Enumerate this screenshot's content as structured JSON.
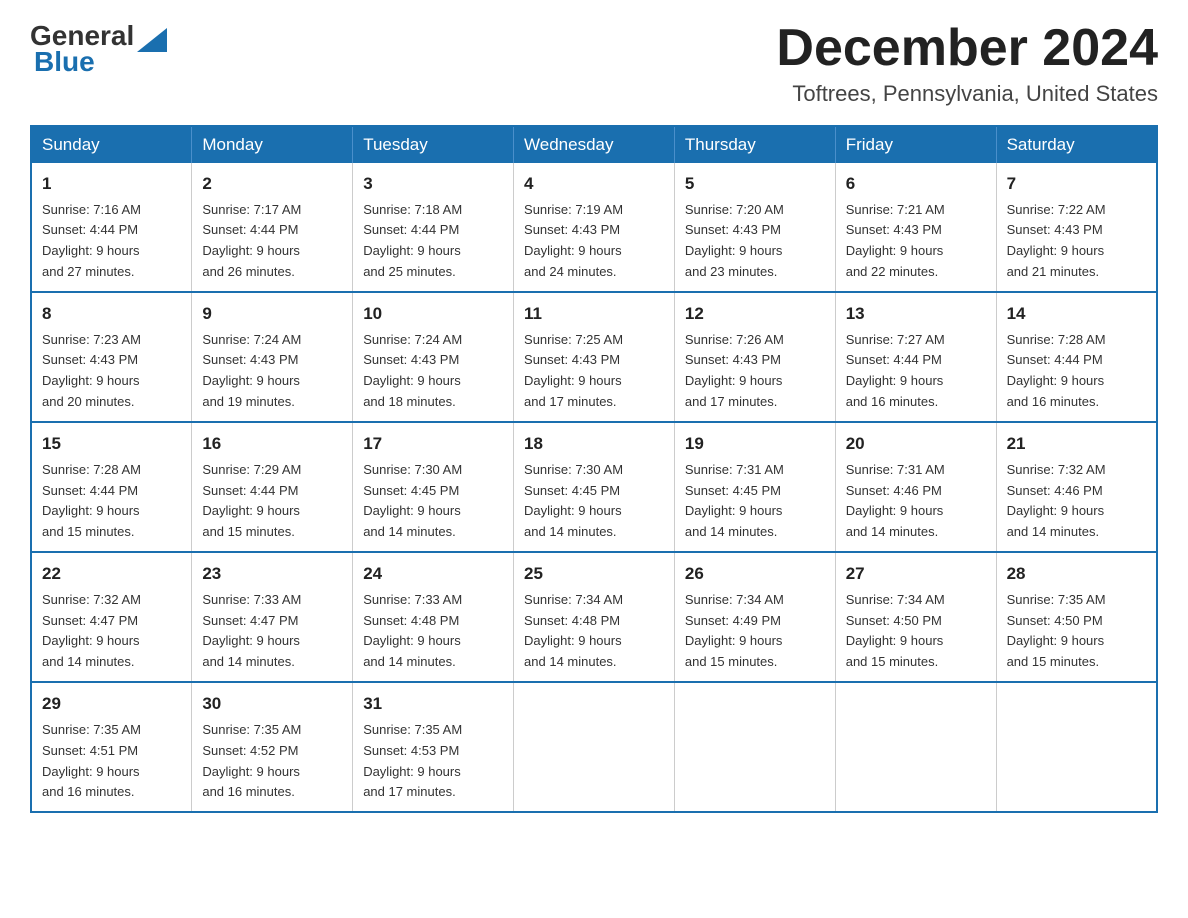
{
  "header": {
    "logo_general": "General",
    "logo_blue": "Blue",
    "month_title": "December 2024",
    "location": "Toftrees, Pennsylvania, United States"
  },
  "weekdays": [
    "Sunday",
    "Monday",
    "Tuesday",
    "Wednesday",
    "Thursday",
    "Friday",
    "Saturday"
  ],
  "weeks": [
    [
      {
        "day": "1",
        "sunrise": "7:16 AM",
        "sunset": "4:44 PM",
        "daylight": "9 hours and 27 minutes."
      },
      {
        "day": "2",
        "sunrise": "7:17 AM",
        "sunset": "4:44 PM",
        "daylight": "9 hours and 26 minutes."
      },
      {
        "day": "3",
        "sunrise": "7:18 AM",
        "sunset": "4:44 PM",
        "daylight": "9 hours and 25 minutes."
      },
      {
        "day": "4",
        "sunrise": "7:19 AM",
        "sunset": "4:43 PM",
        "daylight": "9 hours and 24 minutes."
      },
      {
        "day": "5",
        "sunrise": "7:20 AM",
        "sunset": "4:43 PM",
        "daylight": "9 hours and 23 minutes."
      },
      {
        "day": "6",
        "sunrise": "7:21 AM",
        "sunset": "4:43 PM",
        "daylight": "9 hours and 22 minutes."
      },
      {
        "day": "7",
        "sunrise": "7:22 AM",
        "sunset": "4:43 PM",
        "daylight": "9 hours and 21 minutes."
      }
    ],
    [
      {
        "day": "8",
        "sunrise": "7:23 AM",
        "sunset": "4:43 PM",
        "daylight": "9 hours and 20 minutes."
      },
      {
        "day": "9",
        "sunrise": "7:24 AM",
        "sunset": "4:43 PM",
        "daylight": "9 hours and 19 minutes."
      },
      {
        "day": "10",
        "sunrise": "7:24 AM",
        "sunset": "4:43 PM",
        "daylight": "9 hours and 18 minutes."
      },
      {
        "day": "11",
        "sunrise": "7:25 AM",
        "sunset": "4:43 PM",
        "daylight": "9 hours and 17 minutes."
      },
      {
        "day": "12",
        "sunrise": "7:26 AM",
        "sunset": "4:43 PM",
        "daylight": "9 hours and 17 minutes."
      },
      {
        "day": "13",
        "sunrise": "7:27 AM",
        "sunset": "4:44 PM",
        "daylight": "9 hours and 16 minutes."
      },
      {
        "day": "14",
        "sunrise": "7:28 AM",
        "sunset": "4:44 PM",
        "daylight": "9 hours and 16 minutes."
      }
    ],
    [
      {
        "day": "15",
        "sunrise": "7:28 AM",
        "sunset": "4:44 PM",
        "daylight": "9 hours and 15 minutes."
      },
      {
        "day": "16",
        "sunrise": "7:29 AM",
        "sunset": "4:44 PM",
        "daylight": "9 hours and 15 minutes."
      },
      {
        "day": "17",
        "sunrise": "7:30 AM",
        "sunset": "4:45 PM",
        "daylight": "9 hours and 14 minutes."
      },
      {
        "day": "18",
        "sunrise": "7:30 AM",
        "sunset": "4:45 PM",
        "daylight": "9 hours and 14 minutes."
      },
      {
        "day": "19",
        "sunrise": "7:31 AM",
        "sunset": "4:45 PM",
        "daylight": "9 hours and 14 minutes."
      },
      {
        "day": "20",
        "sunrise": "7:31 AM",
        "sunset": "4:46 PM",
        "daylight": "9 hours and 14 minutes."
      },
      {
        "day": "21",
        "sunrise": "7:32 AM",
        "sunset": "4:46 PM",
        "daylight": "9 hours and 14 minutes."
      }
    ],
    [
      {
        "day": "22",
        "sunrise": "7:32 AM",
        "sunset": "4:47 PM",
        "daylight": "9 hours and 14 minutes."
      },
      {
        "day": "23",
        "sunrise": "7:33 AM",
        "sunset": "4:47 PM",
        "daylight": "9 hours and 14 minutes."
      },
      {
        "day": "24",
        "sunrise": "7:33 AM",
        "sunset": "4:48 PM",
        "daylight": "9 hours and 14 minutes."
      },
      {
        "day": "25",
        "sunrise": "7:34 AM",
        "sunset": "4:48 PM",
        "daylight": "9 hours and 14 minutes."
      },
      {
        "day": "26",
        "sunrise": "7:34 AM",
        "sunset": "4:49 PM",
        "daylight": "9 hours and 15 minutes."
      },
      {
        "day": "27",
        "sunrise": "7:34 AM",
        "sunset": "4:50 PM",
        "daylight": "9 hours and 15 minutes."
      },
      {
        "day": "28",
        "sunrise": "7:35 AM",
        "sunset": "4:50 PM",
        "daylight": "9 hours and 15 minutes."
      }
    ],
    [
      {
        "day": "29",
        "sunrise": "7:35 AM",
        "sunset": "4:51 PM",
        "daylight": "9 hours and 16 minutes."
      },
      {
        "day": "30",
        "sunrise": "7:35 AM",
        "sunset": "4:52 PM",
        "daylight": "9 hours and 16 minutes."
      },
      {
        "day": "31",
        "sunrise": "7:35 AM",
        "sunset": "4:53 PM",
        "daylight": "9 hours and 17 minutes."
      },
      null,
      null,
      null,
      null
    ]
  ],
  "labels": {
    "sunrise": "Sunrise:",
    "sunset": "Sunset:",
    "daylight": "Daylight:"
  }
}
